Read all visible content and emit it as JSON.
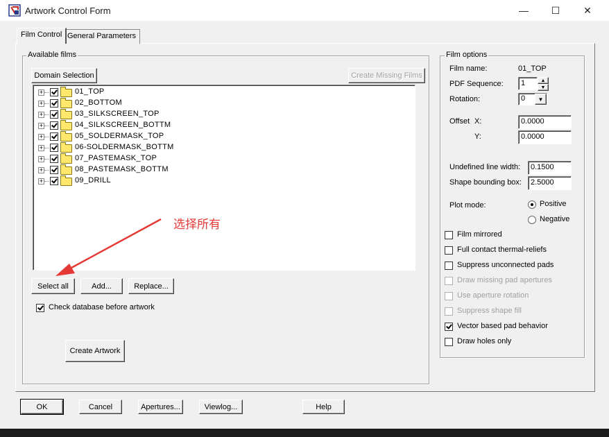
{
  "window": {
    "title": "Artwork Control Form",
    "minimize": "—",
    "maximize": "☐",
    "close": "✕"
  },
  "tabs": [
    {
      "label": "Film Control"
    },
    {
      "label": "General Parameters"
    }
  ],
  "available_films": {
    "group_label": "Available films",
    "domain_button": "Domain Selection",
    "create_missing_button": "Create Missing Films",
    "films": [
      {
        "name": "01_TOP",
        "checked": true
      },
      {
        "name": "02_BOTTOM",
        "checked": true
      },
      {
        "name": "03_SILKSCREEN_TOP",
        "checked": true
      },
      {
        "name": "04_SILKSCREEN_BOTTM",
        "checked": true
      },
      {
        "name": "05_SOLDERMASK_TOP",
        "checked": true
      },
      {
        "name": "06-SOLDERMASK_BOTTM",
        "checked": true
      },
      {
        "name": "07_PASTEMASK_TOP",
        "checked": true
      },
      {
        "name": "08_PASTEMASK_BOTTM",
        "checked": true
      },
      {
        "name": "09_DRILL",
        "checked": true
      }
    ],
    "select_all_button": "Select all",
    "add_button": "Add...",
    "replace_button": "Replace...",
    "check_database_label": "Check database before artwork",
    "create_artwork_button": "Create Artwork"
  },
  "annotation": {
    "text": "选择所有",
    "color": "#e53935"
  },
  "film_options": {
    "group_label": "Film options",
    "film_name_label": "Film name:",
    "film_name_value": "01_TOP",
    "pdf_sequence_label": "PDF Sequence:",
    "pdf_sequence_value": "1",
    "rotation_label": "Rotation:",
    "rotation_value": "0",
    "offset_label": "Offset",
    "offset_x_label": "X:",
    "offset_x_value": "0.0000",
    "offset_y_label": "Y:",
    "offset_y_value": "0.0000",
    "undefined_line_width_label": "Undefined line width:",
    "undefined_line_width_value": "0.1500",
    "shape_bounding_box_label": "Shape bounding box:",
    "shape_bounding_box_value": "2.5000",
    "plot_mode_label": "Plot mode:",
    "plot_modes": [
      {
        "label": "Positive",
        "selected": true
      },
      {
        "label": "Negative",
        "selected": false
      }
    ],
    "options": [
      {
        "label": "Film mirrored",
        "checked": false,
        "enabled": true
      },
      {
        "label": "Full contact thermal-reliefs",
        "checked": false,
        "enabled": true
      },
      {
        "label": "Suppress unconnected pads",
        "checked": false,
        "enabled": true
      },
      {
        "label": "Draw missing pad apertures",
        "checked": false,
        "enabled": false
      },
      {
        "label": "Use aperture rotation",
        "checked": false,
        "enabled": false
      },
      {
        "label": "Suppress shape fill",
        "checked": false,
        "enabled": false
      },
      {
        "label": "Vector based pad behavior",
        "checked": true,
        "enabled": true
      },
      {
        "label": "Draw holes only",
        "checked": false,
        "enabled": true
      }
    ]
  },
  "footer": {
    "ok": "OK",
    "cancel": "Cancel",
    "apertures": "Apertures...",
    "viewlog": "Viewlog...",
    "help": "Help"
  }
}
